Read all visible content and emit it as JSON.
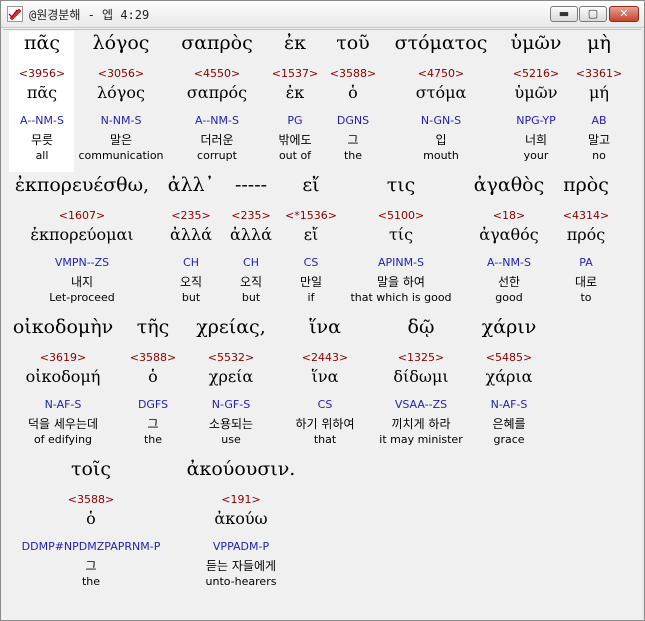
{
  "window": {
    "title": "@원경분해 - 엡 4:29",
    "icon": "pen-check-icon",
    "buttons": {
      "minimize": "▬",
      "maximize": "▢",
      "close": "✕"
    }
  },
  "words": [
    {
      "greek": "πᾶς",
      "num": "<3956>",
      "lemma": "πᾶς",
      "parse": "A--NM-S",
      "korean": "무릇",
      "english": "all"
    },
    {
      "greek": "λόγος",
      "num": "<3056>",
      "lemma": "λόγος",
      "parse": "N-NM-S",
      "korean": "말은",
      "english": "communication"
    },
    {
      "greek": "σαπρὸς",
      "num": "<4550>",
      "lemma": "σαπρός",
      "parse": "A--NM-S",
      "korean": "더러운",
      "english": "corrupt"
    },
    {
      "greek": "ἐκ",
      "num": "<1537>",
      "lemma": "ἐκ",
      "parse": "PG",
      "korean": "밖에도",
      "english": "out of"
    },
    {
      "greek": "τοῦ",
      "num": "<3588>",
      "lemma": "ὁ",
      "parse": "DGNS",
      "korean": "그",
      "english": "the"
    },
    {
      "greek": "στόματος",
      "num": "<4750>",
      "lemma": "στόμα",
      "parse": "N-GN-S",
      "korean": "입",
      "english": "mouth"
    },
    {
      "greek": "ὑμῶν",
      "num": "<5216>",
      "lemma": "ὑμῶν",
      "parse": "NPG-YP",
      "korean": "너희",
      "english": "your"
    },
    {
      "greek": "μὴ",
      "num": "<3361>",
      "lemma": "μή",
      "parse": "AB",
      "korean": "말고",
      "english": "no"
    },
    {
      "greek": "ἐκπορευέσθω,",
      "num": "<1607>",
      "lemma": "ἐκπορεύομαι",
      "parse": "VMPN--ZS",
      "korean": "내지",
      "english": "Let-proceed"
    },
    {
      "greek": "ἀλλ᾽",
      "num": "<235>",
      "lemma": "ἀλλά",
      "parse": "CH",
      "korean": "오직",
      "english": "but"
    },
    {
      "greek": "-----",
      "num": "<235>",
      "lemma": "ἀλλά",
      "parse": "CH",
      "korean": "오직",
      "english": "but"
    },
    {
      "greek": "εἴ",
      "num": "<*1536>",
      "lemma": "εἴ",
      "parse": "CS",
      "korean": "만일",
      "english": "if"
    },
    {
      "greek": "τις",
      "num": "<5100>",
      "lemma": "τίς",
      "parse": "APINM-S",
      "korean": "말을 하여",
      "english": "that which is good"
    },
    {
      "greek": "ἀγαθὸς",
      "num": "<18>",
      "lemma": "ἀγαθός",
      "parse": "A--NM-S",
      "korean": "선한",
      "english": "good"
    },
    {
      "greek": "πρὸς",
      "num": "<4314>",
      "lemma": "πρός",
      "parse": "PA",
      "korean": "대로",
      "english": "to"
    },
    {
      "greek": "οἰκοδομὴν",
      "num": "<3619>",
      "lemma": "οἰκοδομή",
      "parse": "N-AF-S",
      "korean": "덕을 세우는데",
      "english": "of edifying"
    },
    {
      "greek": "τῆς",
      "num": "<3588>",
      "lemma": "ὁ",
      "parse": "DGFS",
      "korean": "그",
      "english": "the"
    },
    {
      "greek": "χρείας,",
      "num": "<5532>",
      "lemma": "χρεία",
      "parse": "N-GF-S",
      "korean": "소용되는",
      "english": "use"
    },
    {
      "greek": "ἵνα",
      "num": "<2443>",
      "lemma": "ἵνα",
      "parse": "CS",
      "korean": "하기 위하여",
      "english": "that"
    },
    {
      "greek": "δῷ",
      "num": "<1325>",
      "lemma": "δίδωμι",
      "parse": "VSAA--ZS",
      "korean": "끼치게 하라",
      "english": "it may minister"
    },
    {
      "greek": "χάριν",
      "num": "<5485>",
      "lemma": "χάρια",
      "parse": "N-AF-S",
      "korean": "은혜를",
      "english": "grace"
    },
    {
      "greek": "τοῖς",
      "num": "<3588>",
      "lemma": "ὁ",
      "parse": "DDMP#NPDMZPAPRNM-P",
      "korean": "그",
      "english": "the"
    },
    {
      "greek": "ἀκούουσιν.",
      "num": "<191>",
      "lemma": "ἀκούω",
      "parse": "VPPADM-P",
      "korean": "듣는 자들에게",
      "english": "unto-hearers"
    }
  ]
}
